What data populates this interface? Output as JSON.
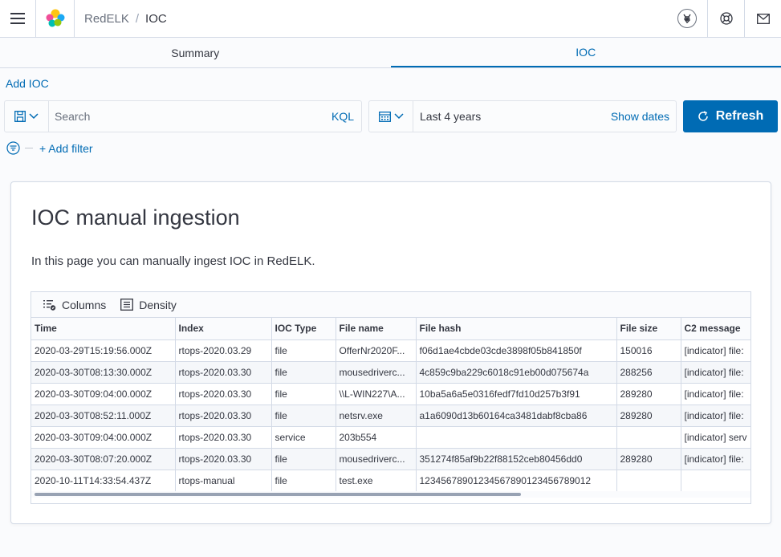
{
  "header": {
    "breadcrumbs": [
      "RedELK",
      "IOC"
    ],
    "breadcrumb_separator": "/",
    "icons": [
      "menu-icon",
      "elastic-logo",
      "user-avatar",
      "help-icon",
      "mail-icon"
    ]
  },
  "tabs": [
    {
      "label": "Summary",
      "active": false
    },
    {
      "label": "IOC",
      "active": true
    }
  ],
  "add_ioc_label": "Add IOC",
  "search": {
    "placeholder": "Search",
    "language": "KQL"
  },
  "date_picker": {
    "value": "Last 4 years",
    "show_dates": "Show dates"
  },
  "refresh_label": "Refresh",
  "filter": {
    "add_label": "+ Add filter"
  },
  "panel": {
    "title": "IOC manual ingestion",
    "description": "In this page you can manually ingest IOC in RedELK."
  },
  "grid": {
    "toolbar": {
      "columns": "Columns",
      "density": "Density"
    },
    "columns": [
      "Time",
      "Index",
      "IOC Type",
      "File name",
      "File hash",
      "File size",
      "C2 message"
    ],
    "rows": [
      [
        "2020-03-29T15:19:56.000Z",
        "rtops-2020.03.29",
        "file",
        "OfferNr2020F...",
        "f06d1ae4cbde03cde3898f05b841850f",
        "150016",
        "[indicator] file:"
      ],
      [
        "2020-03-30T08:13:30.000Z",
        "rtops-2020.03.30",
        "file",
        "mousedriverc...",
        "4c859c9ba229c6018c91eb00d075674a",
        "288256",
        "[indicator] file:"
      ],
      [
        "2020-03-30T09:04:00.000Z",
        "rtops-2020.03.30",
        "file",
        "\\\\L-WIN227\\A...",
        "10ba5a6a5e0316fedf7fd10d257b3f91",
        "289280",
        "[indicator] file:"
      ],
      [
        "2020-03-30T08:52:11.000Z",
        "rtops-2020.03.30",
        "file",
        "netsrv.exe",
        "a1a6090d13b60164ca3481dabf8cba86",
        "289280",
        "[indicator] file:"
      ],
      [
        "2020-03-30T09:04:00.000Z",
        "rtops-2020.03.30",
        "service",
        "203b554",
        "",
        "",
        "[indicator] serv"
      ],
      [
        "2020-03-30T08:07:20.000Z",
        "rtops-2020.03.30",
        "file",
        "mousedriverc...",
        "351274f85af9b22f88152ceb80456dd0",
        "289280",
        "[indicator] file:"
      ],
      [
        "2020-10-11T14:33:54.437Z",
        "rtops-manual",
        "file",
        "test.exe",
        "12345678901234567890123456789012",
        "",
        ""
      ]
    ]
  },
  "colors": {
    "accent": "#006bb4",
    "border": "#d3dae6",
    "text": "#343741",
    "logo_yellow": "#fec514",
    "logo_pink": "#f04e98",
    "logo_teal": "#00bfb3",
    "logo_blue": "#1ba9f5"
  }
}
